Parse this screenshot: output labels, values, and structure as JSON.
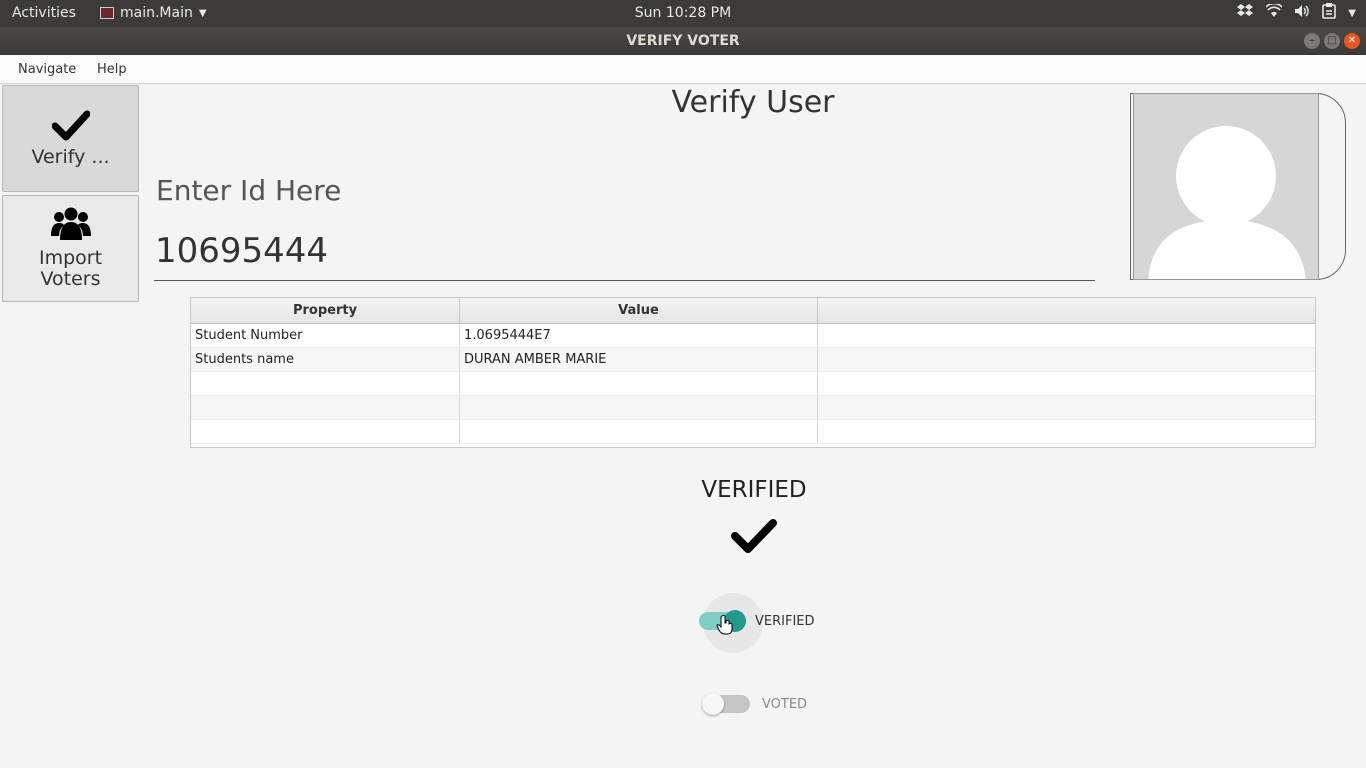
{
  "system": {
    "activities": "Activities",
    "app_menu": "main.Main",
    "clock": "Sun 10:28 PM",
    "tray_icons": [
      "dropbox-icon",
      "wifi-icon",
      "volume-icon",
      "clipboard-icon",
      "caret-down-icon"
    ]
  },
  "window": {
    "title": "VERIFY VOTER"
  },
  "menubar": {
    "items": [
      "Navigate",
      "Help"
    ]
  },
  "sidebar": {
    "verify_label": "Verify ...",
    "import_label": "Import Voters"
  },
  "main": {
    "title": "Verify User",
    "id_label": "Enter Id Here",
    "id_value": "10695444"
  },
  "table": {
    "headers": [
      "Property",
      "Value",
      ""
    ],
    "rows": [
      [
        "Student Number",
        "1.0695444E7",
        ""
      ],
      [
        "Students name",
        "DURAN AMBER MARIE",
        ""
      ],
      [
        "",
        "",
        ""
      ],
      [
        "",
        "",
        ""
      ],
      [
        "",
        "",
        ""
      ]
    ]
  },
  "status": {
    "title": "VERIFIED",
    "verified_toggle_label": "VERIFIED",
    "verified_toggle_on": true,
    "voted_toggle_label": "VOTED",
    "voted_toggle_on": false
  },
  "colors": {
    "accent": "#1f9a8d",
    "accent_light": "#7fcdc4",
    "ubuntu_orange": "#e95420"
  }
}
